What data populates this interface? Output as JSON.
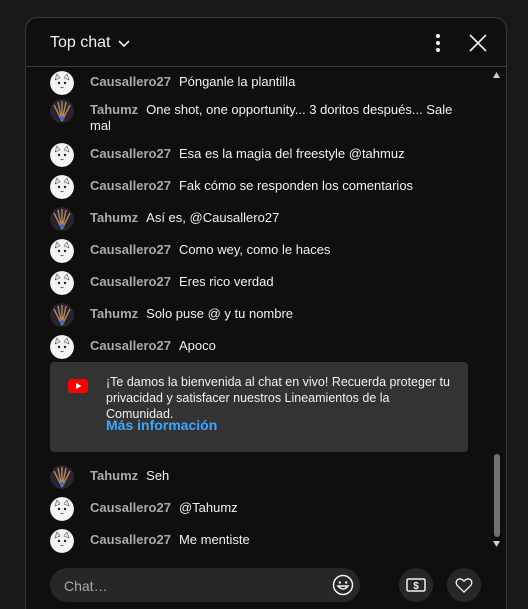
{
  "header": {
    "title": "Top chat",
    "icons": {
      "dropdown": "chevron-down-icon",
      "more": "more-vert-icon",
      "close": "close-icon"
    }
  },
  "messages": [
    {
      "author": "Causallero27",
      "text": "Pónganle la plantilla",
      "avatar": "cat-avatar"
    },
    {
      "author": "Tahumz",
      "text": "One shot, one opportunity... 3 doritos después... Sale mal",
      "avatar": "peacock-avatar"
    },
    {
      "author": "Causallero27",
      "text": "Esa es la magia del freestyle @tahmuz",
      "avatar": "cat-avatar"
    },
    {
      "author": "Causallero27",
      "text": "Fak cómo se responden los comentarios",
      "avatar": "cat-avatar"
    },
    {
      "author": "Tahumz",
      "text": "Así es, @Causallero27",
      "avatar": "peacock-avatar"
    },
    {
      "author": "Causallero27",
      "text": "Como wey, como le haces",
      "avatar": "cat-avatar"
    },
    {
      "author": "Causallero27",
      "text": "Eres rico verdad",
      "avatar": "cat-avatar"
    },
    {
      "author": "Tahumz",
      "text": "Solo puse @ y tu nombre",
      "avatar": "peacock-avatar"
    },
    {
      "author": "Causallero27",
      "text": "Apoco",
      "avatar": "cat-avatar"
    },
    {
      "author": "Tahumz",
      "text": "Seh",
      "avatar": "peacock-avatar"
    },
    {
      "author": "Causallero27",
      "text": "@Tahumz",
      "avatar": "cat-avatar"
    },
    {
      "author": "Causallero27",
      "text": "Me mentiste",
      "avatar": "cat-avatar"
    }
  ],
  "welcome": {
    "text": "¡Te damos la bienvenida al chat en vivo! Recuerda proteger tu privacidad y satisfacer nuestros Lineamientos de la Comunidad.",
    "link": "Más información",
    "icon": "youtube-logo-icon"
  },
  "composer": {
    "placeholder": "Chat…",
    "value": ""
  },
  "colors": {
    "background": "#0f0f0f",
    "author": "#aaaaaa",
    "link": "#3ea6ff",
    "youtube_red": "#ff0000"
  }
}
